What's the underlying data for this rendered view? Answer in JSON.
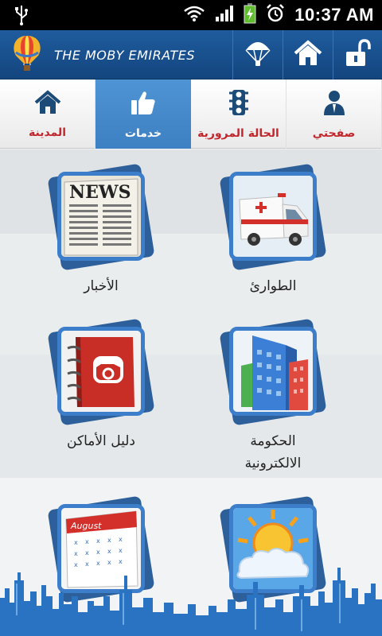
{
  "status_bar": {
    "time": "10:37 AM"
  },
  "header": {
    "brand_title": "THE MOBY EMIRATES",
    "buttons": [
      {
        "name": "parachute-button",
        "icon": "parachute-icon"
      },
      {
        "name": "home-button",
        "icon": "home-icon"
      },
      {
        "name": "unlock-button",
        "icon": "unlock-icon"
      }
    ]
  },
  "tabs": [
    {
      "label": "المدينة",
      "icon": "home-icon",
      "active": false
    },
    {
      "label": "خدمات",
      "icon": "thumbs-up-icon",
      "active": true
    },
    {
      "label": "الحالة المرورية",
      "icon": "traffic-light-icon",
      "active": false
    },
    {
      "label": "صفحتي",
      "icon": "user-icon",
      "active": false
    }
  ],
  "tiles": {
    "emergency": {
      "label": "الطوارئ",
      "icon": "ambulance-icon"
    },
    "news": {
      "label": "الأخبار",
      "icon": "newspaper-icon"
    },
    "egov_line1": "الحكومة",
    "egov_line2": "الالكترونية",
    "egov_icon": "buildings-icon",
    "directory": {
      "label": "دليل الأماكن",
      "icon": "phone-book-icon"
    },
    "calendar": {
      "icon": "calendar-icon",
      "month": "August"
    },
    "weather": {
      "icon": "weather-icon"
    }
  },
  "colors": {
    "header_blue": "#1f5c9e",
    "active_tab": "#4f94d4",
    "tab_label_red": "#c0272d",
    "icon_frame": "#3d7ecb"
  }
}
